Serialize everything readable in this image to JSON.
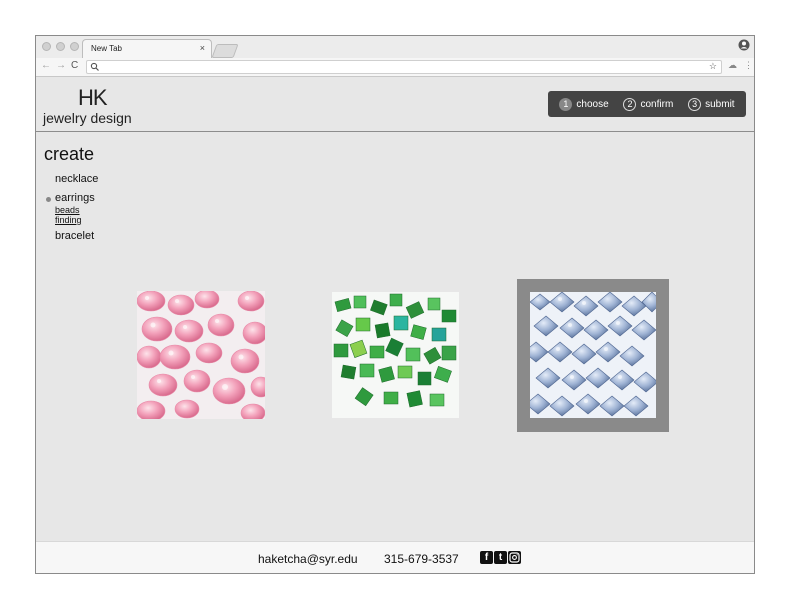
{
  "browser": {
    "tab_title": "New Tab",
    "tab_close": "×"
  },
  "site": {
    "logo_mark": "HK",
    "logo_text": "jewelry design"
  },
  "steps": [
    {
      "num": "1",
      "label": "choose",
      "active": true
    },
    {
      "num": "2",
      "label": "confirm",
      "active": false
    },
    {
      "num": "3",
      "label": "submit",
      "active": false
    }
  ],
  "sidebar": {
    "title": "create",
    "items": [
      {
        "label": "necklace"
      },
      {
        "label": "earrings",
        "selected": true,
        "sub": [
          "beads",
          "finding"
        ]
      },
      {
        "label": "bracelet"
      }
    ]
  },
  "beads": [
    {
      "name": "pink-crystal-beads",
      "selected": false
    },
    {
      "name": "green-glass-beads",
      "selected": false
    },
    {
      "name": "blue-crystal-beads",
      "selected": true
    }
  ],
  "footer": {
    "email": "haketcha@syr.edu",
    "phone": "315-679-3537",
    "social": [
      "f",
      "t",
      "i"
    ]
  },
  "colors": {
    "page_bg": "#e7e7e7",
    "step_bar": "#444444",
    "selection_frame": "#8a8a8a"
  }
}
